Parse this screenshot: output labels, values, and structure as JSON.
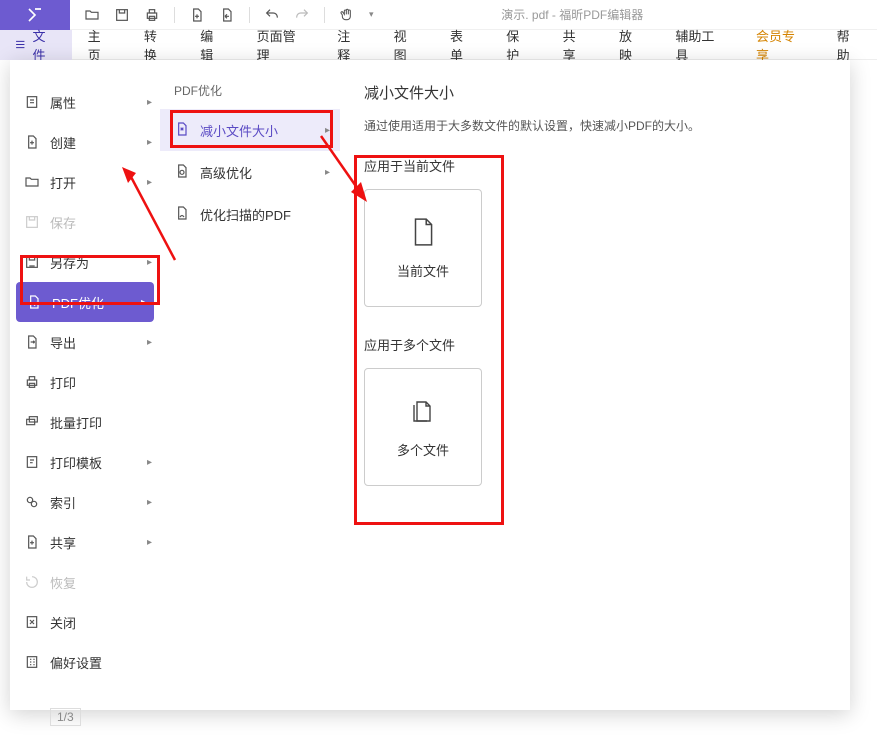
{
  "titlebar": {
    "doc_title": "演示. pdf - 福昕PDF编辑器"
  },
  "ribbon": {
    "file_tab": "文件",
    "tabs": [
      "主页",
      "转换",
      "编辑",
      "页面管理",
      "注释",
      "视图",
      "表单",
      "保护",
      "共享",
      "放映",
      "辅助工具",
      "会员专享",
      "帮助"
    ]
  },
  "backstage": {
    "menu": [
      {
        "label": "属性",
        "icon": "info",
        "arrow": true
      },
      {
        "label": "创建",
        "icon": "new",
        "arrow": true
      },
      {
        "label": "打开",
        "icon": "open",
        "arrow": true
      },
      {
        "label": "保存",
        "icon": "save",
        "arrow": false,
        "disabled": true
      },
      {
        "label": "另存为",
        "icon": "saveas",
        "arrow": true
      },
      {
        "label": "PDF优化",
        "icon": "optimize",
        "arrow": true,
        "selected": true
      },
      {
        "label": "导出",
        "icon": "export",
        "arrow": true
      },
      {
        "label": "打印",
        "icon": "print",
        "arrow": false
      },
      {
        "label": "批量打印",
        "icon": "batchprint",
        "arrow": false
      },
      {
        "label": "打印模板",
        "icon": "printtpl",
        "arrow": true
      },
      {
        "label": "索引",
        "icon": "index",
        "arrow": true
      },
      {
        "label": "共享",
        "icon": "share",
        "arrow": true
      },
      {
        "label": "恢复",
        "icon": "restore",
        "arrow": false,
        "disabled": true
      },
      {
        "label": "关闭",
        "icon": "close",
        "arrow": false
      },
      {
        "label": "偏好设置",
        "icon": "pref",
        "arrow": false
      }
    ],
    "col2": {
      "heading": "PDF优化",
      "items": [
        {
          "label": "减小文件大小",
          "active": true
        },
        {
          "label": "高级优化"
        },
        {
          "label": "优化扫描的PDF"
        }
      ]
    },
    "detail": {
      "title": "减小文件大小",
      "desc": "通过使用适用于大多数文件的默认设置，快速减小PDF的大小。",
      "section1": "应用于当前文件",
      "card1": "当前文件",
      "section2": "应用于多个文件",
      "card2": "多个文件"
    }
  },
  "status": {
    "page": "1/3"
  }
}
